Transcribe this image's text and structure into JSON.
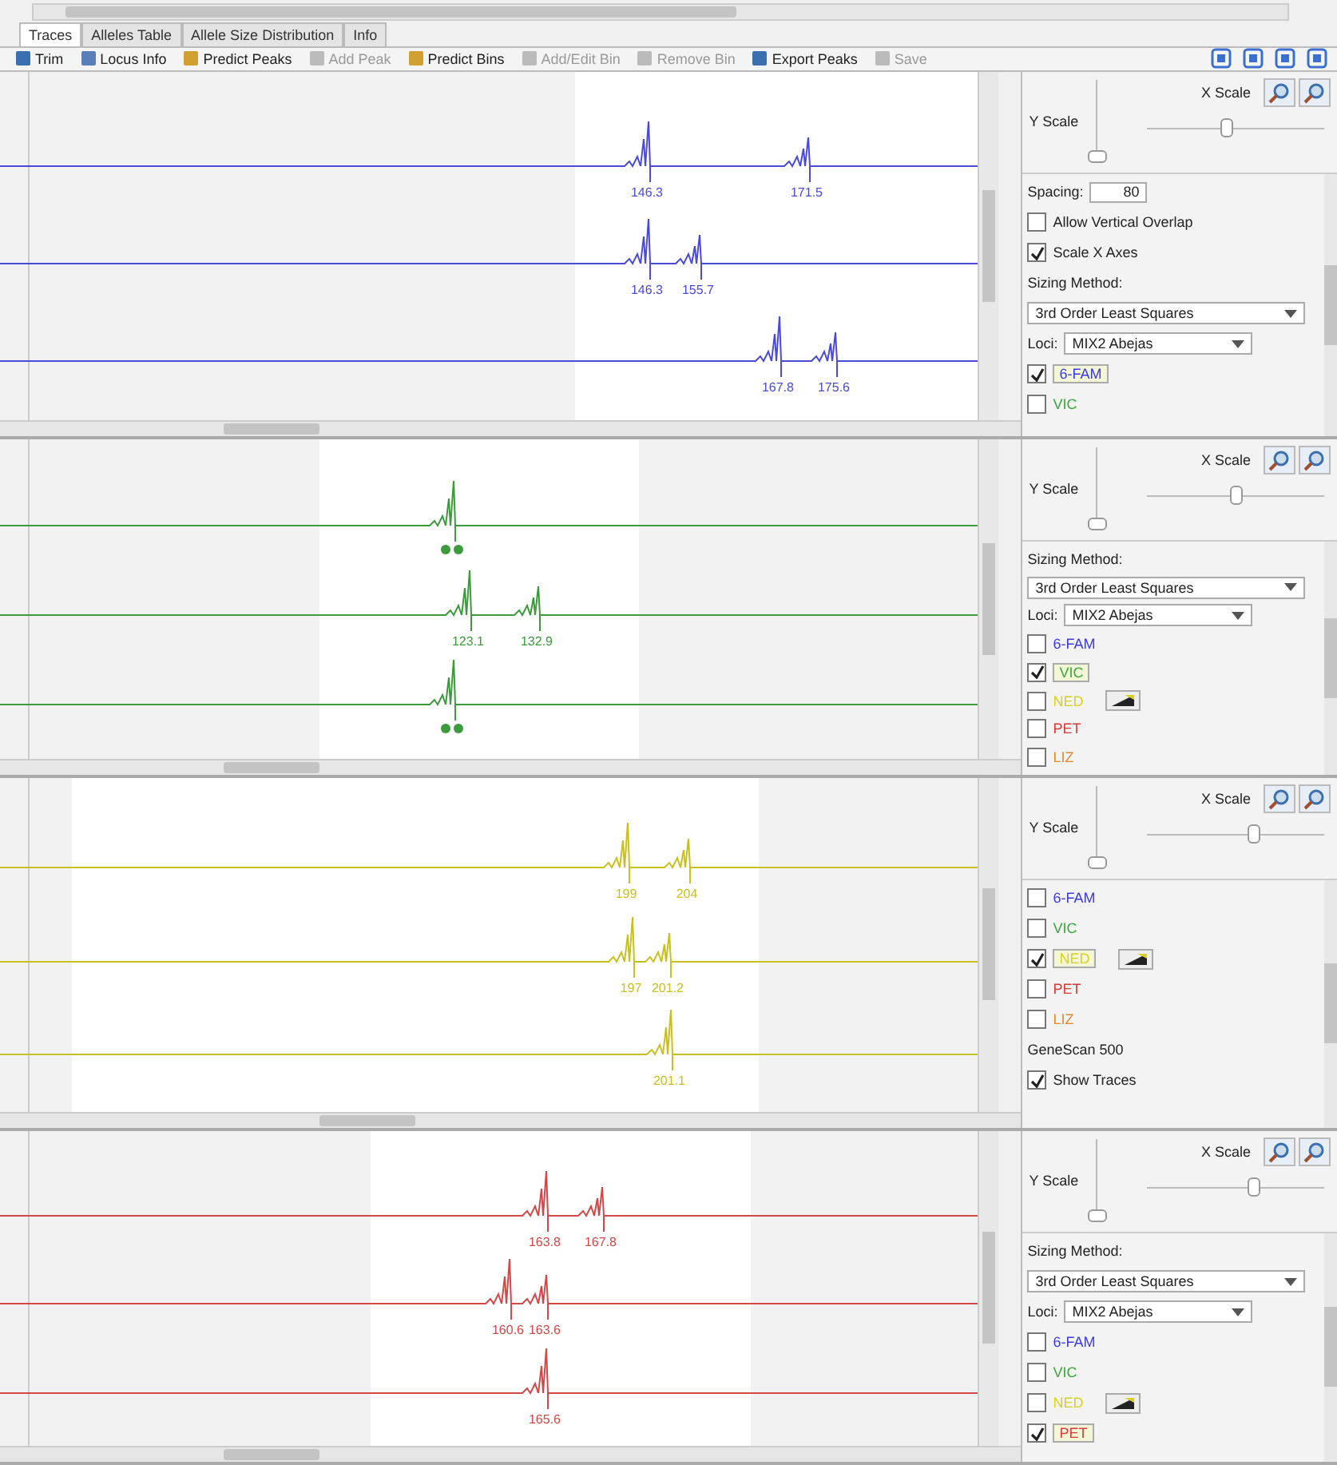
{
  "tabs": [
    {
      "label": "Traces",
      "selected": true
    },
    {
      "label": "Alleles Table",
      "selected": false
    },
    {
      "label": "Allele Size Distribution",
      "selected": false
    },
    {
      "label": "Info",
      "selected": false
    }
  ],
  "toolbar": [
    {
      "label": "Trim",
      "disabled": false
    },
    {
      "label": "Locus Info",
      "disabled": false
    },
    {
      "label": "Predict Peaks",
      "disabled": false
    },
    {
      "label": "Add Peak",
      "disabled": true
    },
    {
      "label": "Predict Bins",
      "disabled": false
    },
    {
      "label": "Add/Edit Bin",
      "disabled": true
    },
    {
      "label": "Remove Bin",
      "disabled": true
    },
    {
      "label": "Export Peaks",
      "disabled": false
    },
    {
      "label": "Save",
      "disabled": true
    }
  ],
  "panels": [
    {
      "color": "#4a4ad8",
      "traces": [
        {
          "peak_labels": [
            "146.3",
            "171.5"
          ]
        },
        {
          "peak_labels": [
            "146.3",
            "155.7"
          ]
        },
        {
          "peak_labels": [
            "167.8",
            "175.6"
          ]
        }
      ],
      "y_scale": {
        "label": "Y Scale",
        "level": 0
      },
      "x_scale": {
        "label": "X Scale",
        "level": 0.45
      },
      "options": [
        {
          "kind": "spacing",
          "label": "Spacing:",
          "value": "80"
        },
        {
          "kind": "checkbox",
          "label": "Allow Vertical Overlap",
          "checked": false
        },
        {
          "kind": "checkbox",
          "label": "Scale X Axes",
          "checked": true
        },
        {
          "kind": "heading",
          "label": "Sizing Method:"
        },
        {
          "kind": "dropdown",
          "value": "3rd Order Least Squares"
        },
        {
          "kind": "loci",
          "label": "Loci:",
          "value": "MIX2 Abejas"
        },
        {
          "kind": "dye",
          "label": "6-FAM",
          "color": "#3a3ae0",
          "checked": true
        },
        {
          "kind": "dye",
          "label": "VIC",
          "color": "#3aa83a",
          "checked": false
        }
      ]
    },
    {
      "color": "#3c9a3c",
      "traces": [
        {
          "kind": "dots"
        },
        {
          "kind": "labels",
          "peak_labels": [
            "123.1",
            "132.9"
          ]
        },
        {
          "kind": "dots"
        }
      ],
      "y_scale": {
        "label": "Y Scale",
        "level": 0
      },
      "x_scale": {
        "label": "X Scale",
        "level": 0.5
      },
      "options": [
        {
          "kind": "heading",
          "label": "Sizing Method:"
        },
        {
          "kind": "dropdown",
          "value": "3rd Order Least Squares"
        },
        {
          "kind": "loci",
          "label": "Loci:",
          "value": "MIX2 Abejas"
        },
        {
          "kind": "dye",
          "label": "6-FAM",
          "color": "#3a3ae0",
          "checked": false
        },
        {
          "kind": "dye",
          "label": "VIC",
          "color": "#3aa83a",
          "checked": true
        },
        {
          "kind": "dye",
          "label": "NED",
          "color": "#d8d020",
          "checked": false,
          "swatch": true
        },
        {
          "kind": "dye",
          "label": "PET",
          "color": "#d83a3a",
          "checked": false
        },
        {
          "kind": "dye",
          "label": "LIZ",
          "color": "#e08a30",
          "checked": false
        }
      ]
    },
    {
      "color": "#c8c020",
      "traces": [
        {
          "peak_labels": [
            "199",
            "204"
          ]
        },
        {
          "peak_labels": [
            "197",
            "201.2"
          ]
        },
        {
          "peak_labels": [
            "201.1"
          ]
        }
      ],
      "y_scale": {
        "label": "Y Scale",
        "level": 0
      },
      "x_scale": {
        "label": "X Scale",
        "level": 0.6
      },
      "options": [
        {
          "kind": "dye",
          "label": "6-FAM",
          "color": "#3a3ae0",
          "checked": false
        },
        {
          "kind": "dye",
          "label": "VIC",
          "color": "#3aa83a",
          "checked": false
        },
        {
          "kind": "dye",
          "label": "NED",
          "color": "#d8d020",
          "checked": true,
          "swatch": true
        },
        {
          "kind": "dye",
          "label": "PET",
          "color": "#d83a3a",
          "checked": false
        },
        {
          "kind": "dye",
          "label": "LIZ",
          "color": "#e08a30",
          "checked": false
        },
        {
          "kind": "heading",
          "label": "GeneScan 500"
        },
        {
          "kind": "checkbox",
          "label": "Show Traces",
          "checked": true
        }
      ]
    },
    {
      "color": "#d04848",
      "traces": [
        {
          "peak_labels": [
            "163.8",
            "167.8"
          ]
        },
        {
          "peak_labels": [
            "160.6",
            "163.6"
          ]
        },
        {
          "peak_labels": [
            "165.6"
          ]
        }
      ],
      "y_scale": {
        "label": "Y Scale",
        "level": 0
      },
      "x_scale": {
        "label": "X Scale",
        "level": 0.6
      },
      "options": [
        {
          "kind": "heading",
          "label": "Sizing Method:"
        },
        {
          "kind": "dropdown",
          "value": "3rd Order Least Squares"
        },
        {
          "kind": "loci",
          "label": "Loci:",
          "value": "MIX2 Abejas"
        },
        {
          "kind": "dye",
          "label": "6-FAM",
          "color": "#3a3ae0",
          "checked": false
        },
        {
          "kind": "dye",
          "label": "VIC",
          "color": "#3aa83a",
          "checked": false
        },
        {
          "kind": "dye",
          "label": "NED",
          "color": "#d8d020",
          "checked": false,
          "swatch": true
        },
        {
          "kind": "dye",
          "label": "PET",
          "color": "#d83a3a",
          "checked": true
        }
      ]
    }
  ]
}
